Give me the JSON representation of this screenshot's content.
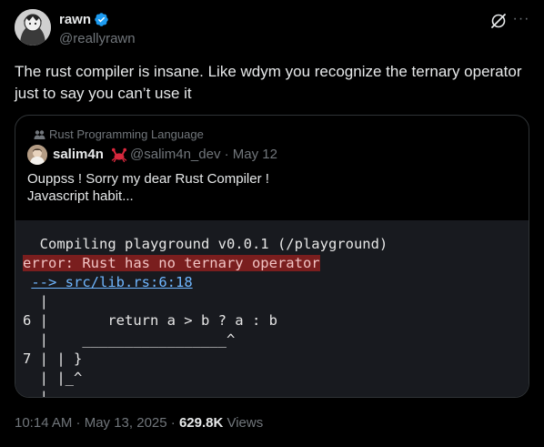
{
  "author": {
    "name": "rawn",
    "handle": "@reallyrawn"
  },
  "tweet": {
    "text": "The rust compiler is insane. Like wdym you recognize the ternary operator just to say you can’t use it"
  },
  "quote": {
    "community": "Rust Programming Language",
    "name": "salim4n",
    "handle": "@salim4n_dev · May 12",
    "text_line1": "Ouppss ! Sorry my dear Rust Compiler !",
    "text_line2": "Javascript habit...",
    "code": {
      "l1": "  Compiling playground v0.0.1 (/playground)",
      "l2": "error: Rust has no ternary operator",
      "l3_prefix": " ",
      "l3_link": "--> src/lib.rs:6:18",
      "l4": "  |",
      "l5": "6 |       return a > b ? a : b",
      "l6": "  |    _________________^",
      "l7": "7 | | }",
      "l8": "  | |_^",
      "l9": "  |"
    }
  },
  "footer": {
    "time": "10:14 AM · May 13, 2025 · ",
    "views_count": "629.8K",
    "views_label": " Views"
  },
  "colors": {
    "background": "#000000",
    "text": "#e7e9ea",
    "muted": "#71767b",
    "verified": "#1d9bf0",
    "code_bg": "#181a1f",
    "error_bg": "#7a1e1e",
    "link": "#6fb6ff"
  }
}
